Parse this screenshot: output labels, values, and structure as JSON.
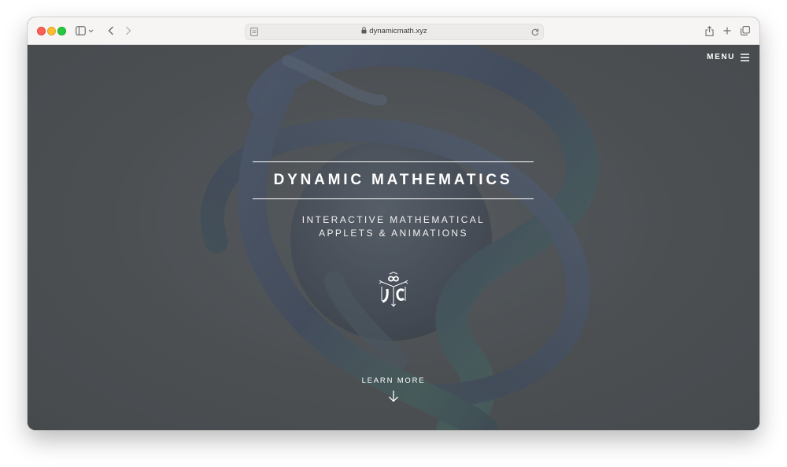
{
  "browser": {
    "url": "dynamicmath.xyz"
  },
  "site": {
    "menu_label": "MENU",
    "title": "DYNAMIC MATHEMATICS",
    "subtitle_line1": "INTERACTIVE MATHEMATICAL",
    "subtitle_line2": "APPLETS & ANIMATIONS",
    "learn_more": "LEARN MORE"
  },
  "icons": {
    "sidebar": "sidebar-icon",
    "back": "chevron-left-icon",
    "forward": "chevron-right-icon",
    "reader": "reader-icon",
    "lock": "lock-icon",
    "reload": "reload-icon",
    "share": "share-icon",
    "new_tab": "plus-icon",
    "tabs": "tabs-icon",
    "menu": "hamburger-icon",
    "arrow_down": "arrow-down-icon",
    "logo": "dm-logo-icon"
  },
  "colors": {
    "hero_bg": "#4b4f52",
    "toolbar_bg": "#f6f5f4",
    "text": "#ffffff"
  }
}
